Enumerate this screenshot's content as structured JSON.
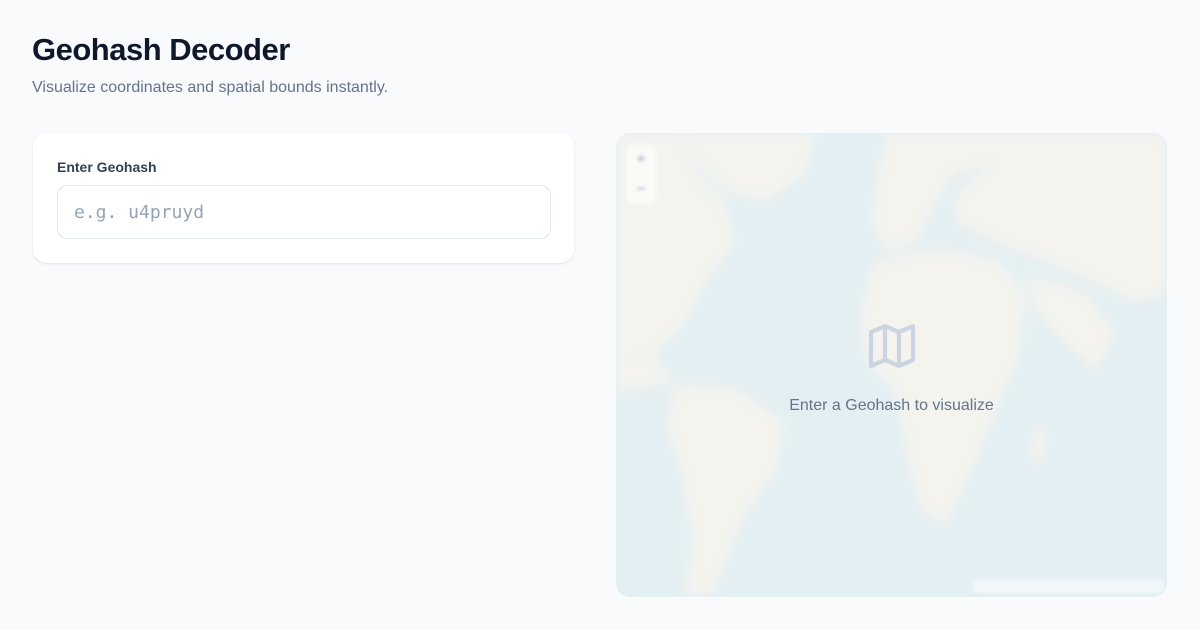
{
  "header": {
    "title": "Geohash Decoder",
    "subtitle": "Visualize coordinates and spatial bounds instantly."
  },
  "input_card": {
    "label": "Enter Geohash",
    "placeholder": "e.g. u4pruyd",
    "value": ""
  },
  "map": {
    "empty_message": "Enter a Geohash to visualize",
    "icon": "map-icon",
    "zoom_in_label": "+",
    "zoom_out_label": "−"
  },
  "colors": {
    "background": "#f8fafc",
    "water": "#dcebf0",
    "land": "#f3f1ea",
    "text_muted": "#64748b",
    "icon": "#cbd5e1"
  }
}
